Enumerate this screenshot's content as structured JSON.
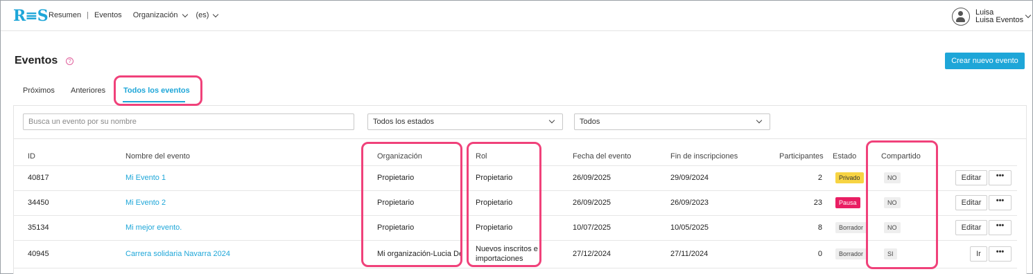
{
  "header": {
    "logo": "R≡S",
    "nav": [
      "Resumen",
      "Eventos",
      "Organización",
      "(es)"
    ],
    "user_name": "Luisa",
    "user_org": "Luisa Eventos"
  },
  "page": {
    "title": "Eventos",
    "create_button": "Crear nuevo evento"
  },
  "tabs": [
    "Próximos",
    "Anteriores",
    "Todos los eventos"
  ],
  "filters": {
    "search_placeholder": "Busca un evento por su nombre",
    "state": "Todos los estados",
    "role": "Todos"
  },
  "table": {
    "columns": [
      "ID",
      "Nombre del evento",
      "Organización",
      "Rol",
      "Fecha del evento",
      "Fin de inscripciones",
      "Participantes",
      "Estado",
      "Compartido"
    ],
    "rows": [
      {
        "id": "40817",
        "name": "Mi Evento 1",
        "org": "Propietario",
        "rol": "Propietario",
        "fecha": "26/09/2025",
        "fin": "29/09/2024",
        "part": "2",
        "estado": "Privado",
        "compartido": "NO",
        "action": "Editar"
      },
      {
        "id": "34450",
        "name": "Mi Evento 2",
        "org": "Propietario",
        "rol": "Propietario",
        "fecha": "26/09/2025",
        "fin": "26/09/2023",
        "part": "23",
        "estado": "Pausa",
        "compartido": "NO",
        "action": "Editar"
      },
      {
        "id": "35134",
        "name": "Mi mejor evento.",
        "org": "Propietario",
        "rol": "Propietario",
        "fecha": "10/07/2025",
        "fin": "10/05/2025",
        "part": "8",
        "estado": "Borrador",
        "compartido": "NO",
        "action": "Editar"
      },
      {
        "id": "40945",
        "name": "Carrera solidaria Navarra 2024",
        "org": "Mi organización-Lucia Demo",
        "rol_line1": "Nuevos inscritos e",
        "rol_line2": "importaciones",
        "fecha": "27/12/2024",
        "fin": "27/11/2024",
        "part": "0",
        "estado": "Borrador",
        "compartido": "SI",
        "action": "Ir"
      }
    ],
    "more_label": "•••"
  },
  "colors": {
    "accent": "#1ea6d8",
    "highlight": "#f0417a",
    "privado": "#f7d443",
    "pausa": "#e91e63"
  }
}
